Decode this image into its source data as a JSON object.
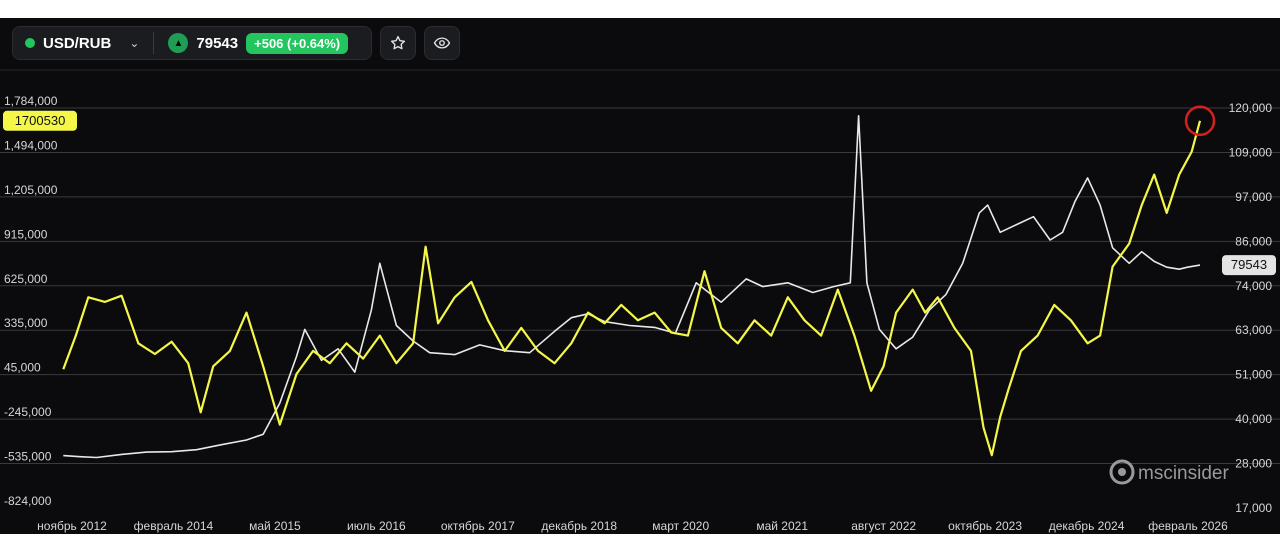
{
  "toolbar": {
    "pair": "USD/RUB",
    "price": "79543",
    "change": "+506 (+0.64%)",
    "icons": [
      "status-dot",
      "chevron-down-icon",
      "triangle-up-icon",
      "star-icon",
      "eye-icon"
    ]
  },
  "watermark": "mscinsider",
  "colors": {
    "background": "#0b0b0d",
    "left_series": "#f4f748",
    "right_series": "#e8e8e8",
    "gain": "#22c55e",
    "highlight_circle": "#d61f1f"
  },
  "chart_data": {
    "type": "line",
    "grid": "horizontal",
    "x_ticks": [
      "ноябрь 2012",
      "февраль 2014",
      "май 2015",
      "июль 2016",
      "октябрь 2017",
      "декабрь 2018",
      "март 2020",
      "май 2021",
      "август 2022",
      "октябрь 2023",
      "декабрь 2024",
      "февраль 2026"
    ],
    "x_range": [
      2012.5,
      2026.55
    ],
    "y_left": {
      "ticks": [
        "1,784,000",
        "1,494,000",
        "1,205,000",
        "915,000",
        "625,000",
        "335,000",
        "45,000",
        "-245,000",
        "-535,000",
        "-824,000"
      ],
      "range": [
        -824000,
        1784000
      ]
    },
    "y_right": {
      "ticks": [
        "120,000",
        "109,000",
        "97,000",
        "86,000",
        "74,000",
        "63,000",
        "51,000",
        "40,000",
        "28,000",
        "17,000"
      ],
      "range": [
        17000,
        120000
      ]
    },
    "last_value_labels": {
      "left": "1700530",
      "right": "79543"
    },
    "series": [
      {
        "axis": "left",
        "points": [
          [
            2012.6,
            80000
          ],
          [
            2012.75,
            300000
          ],
          [
            2012.9,
            550000
          ],
          [
            2013.1,
            520000
          ],
          [
            2013.3,
            560000
          ],
          [
            2013.5,
            250000
          ],
          [
            2013.7,
            180000
          ],
          [
            2013.9,
            260000
          ],
          [
            2014.1,
            120000
          ],
          [
            2014.25,
            -200000
          ],
          [
            2014.4,
            100000
          ],
          [
            2014.6,
            200000
          ],
          [
            2014.8,
            450000
          ],
          [
            2015.0,
            100000
          ],
          [
            2015.2,
            -280000
          ],
          [
            2015.4,
            50000
          ],
          [
            2015.6,
            200000
          ],
          [
            2015.8,
            120000
          ],
          [
            2016.0,
            250000
          ],
          [
            2016.2,
            150000
          ],
          [
            2016.4,
            300000
          ],
          [
            2016.6,
            120000
          ],
          [
            2016.8,
            250000
          ],
          [
            2016.95,
            880000
          ],
          [
            2017.1,
            380000
          ],
          [
            2017.3,
            550000
          ],
          [
            2017.5,
            650000
          ],
          [
            2017.7,
            400000
          ],
          [
            2017.9,
            200000
          ],
          [
            2018.1,
            350000
          ],
          [
            2018.3,
            200000
          ],
          [
            2018.5,
            120000
          ],
          [
            2018.7,
            250000
          ],
          [
            2018.9,
            450000
          ],
          [
            2019.1,
            380000
          ],
          [
            2019.3,
            500000
          ],
          [
            2019.5,
            400000
          ],
          [
            2019.7,
            450000
          ],
          [
            2019.9,
            320000
          ],
          [
            2020.1,
            300000
          ],
          [
            2020.3,
            720000
          ],
          [
            2020.5,
            350000
          ],
          [
            2020.7,
            250000
          ],
          [
            2020.9,
            400000
          ],
          [
            2021.1,
            300000
          ],
          [
            2021.3,
            550000
          ],
          [
            2021.5,
            400000
          ],
          [
            2021.7,
            300000
          ],
          [
            2021.9,
            600000
          ],
          [
            2022.1,
            300000
          ],
          [
            2022.3,
            -60000
          ],
          [
            2022.45,
            100000
          ],
          [
            2022.6,
            450000
          ],
          [
            2022.8,
            600000
          ],
          [
            2022.95,
            450000
          ],
          [
            2023.1,
            550000
          ],
          [
            2023.3,
            350000
          ],
          [
            2023.5,
            200000
          ],
          [
            2023.65,
            -300000
          ],
          [
            2023.75,
            -480000
          ],
          [
            2023.85,
            -230000
          ],
          [
            2023.95,
            -50000
          ],
          [
            2024.1,
            200000
          ],
          [
            2024.3,
            300000
          ],
          [
            2024.5,
            500000
          ],
          [
            2024.7,
            400000
          ],
          [
            2024.9,
            250000
          ],
          [
            2025.05,
            300000
          ],
          [
            2025.2,
            750000
          ],
          [
            2025.4,
            900000
          ],
          [
            2025.55,
            1150000
          ],
          [
            2025.7,
            1350000
          ],
          [
            2025.85,
            1100000
          ],
          [
            2026.0,
            1350000
          ],
          [
            2026.15,
            1500000
          ],
          [
            2026.25,
            1700530
          ]
        ]
      },
      {
        "axis": "right",
        "points": [
          [
            2012.6,
            30500
          ],
          [
            2012.8,
            30200
          ],
          [
            2013.0,
            30000
          ],
          [
            2013.3,
            30800
          ],
          [
            2013.6,
            31400
          ],
          [
            2013.9,
            31500
          ],
          [
            2014.2,
            32000
          ],
          [
            2014.5,
            33300
          ],
          [
            2014.8,
            34500
          ],
          [
            2015.0,
            36000
          ],
          [
            2015.2,
            44000
          ],
          [
            2015.4,
            56000
          ],
          [
            2015.5,
            63000
          ],
          [
            2015.7,
            55000
          ],
          [
            2015.9,
            58000
          ],
          [
            2016.1,
            52000
          ],
          [
            2016.3,
            68000
          ],
          [
            2016.4,
            80000
          ],
          [
            2016.6,
            64000
          ],
          [
            2016.8,
            60000
          ],
          [
            2017.0,
            57000
          ],
          [
            2017.3,
            56500
          ],
          [
            2017.6,
            59000
          ],
          [
            2017.9,
            57500
          ],
          [
            2018.2,
            57000
          ],
          [
            2018.5,
            62500
          ],
          [
            2018.7,
            66000
          ],
          [
            2018.9,
            67000
          ],
          [
            2019.1,
            65000
          ],
          [
            2019.4,
            64000
          ],
          [
            2019.7,
            63500
          ],
          [
            2019.95,
            62000
          ],
          [
            2020.2,
            75000
          ],
          [
            2020.5,
            70000
          ],
          [
            2020.8,
            76000
          ],
          [
            2021.0,
            74000
          ],
          [
            2021.3,
            75000
          ],
          [
            2021.6,
            72500
          ],
          [
            2021.85,
            74000
          ],
          [
            2022.05,
            75000
          ],
          [
            2022.15,
            118000
          ],
          [
            2022.25,
            75000
          ],
          [
            2022.4,
            63000
          ],
          [
            2022.6,
            58000
          ],
          [
            2022.8,
            61000
          ],
          [
            2023.0,
            68000
          ],
          [
            2023.2,
            72000
          ],
          [
            2023.4,
            80000
          ],
          [
            2023.6,
            93000
          ],
          [
            2023.7,
            95000
          ],
          [
            2023.85,
            88000
          ],
          [
            2024.05,
            90000
          ],
          [
            2024.25,
            92000
          ],
          [
            2024.45,
            86000
          ],
          [
            2024.6,
            88000
          ],
          [
            2024.75,
            96000
          ],
          [
            2024.9,
            102000
          ],
          [
            2025.05,
            95000
          ],
          [
            2025.2,
            84000
          ],
          [
            2025.4,
            80000
          ],
          [
            2025.55,
            83000
          ],
          [
            2025.7,
            80500
          ],
          [
            2025.85,
            79000
          ],
          [
            2026.0,
            78500
          ],
          [
            2026.1,
            79000
          ],
          [
            2026.25,
            79543
          ]
        ]
      }
    ]
  }
}
